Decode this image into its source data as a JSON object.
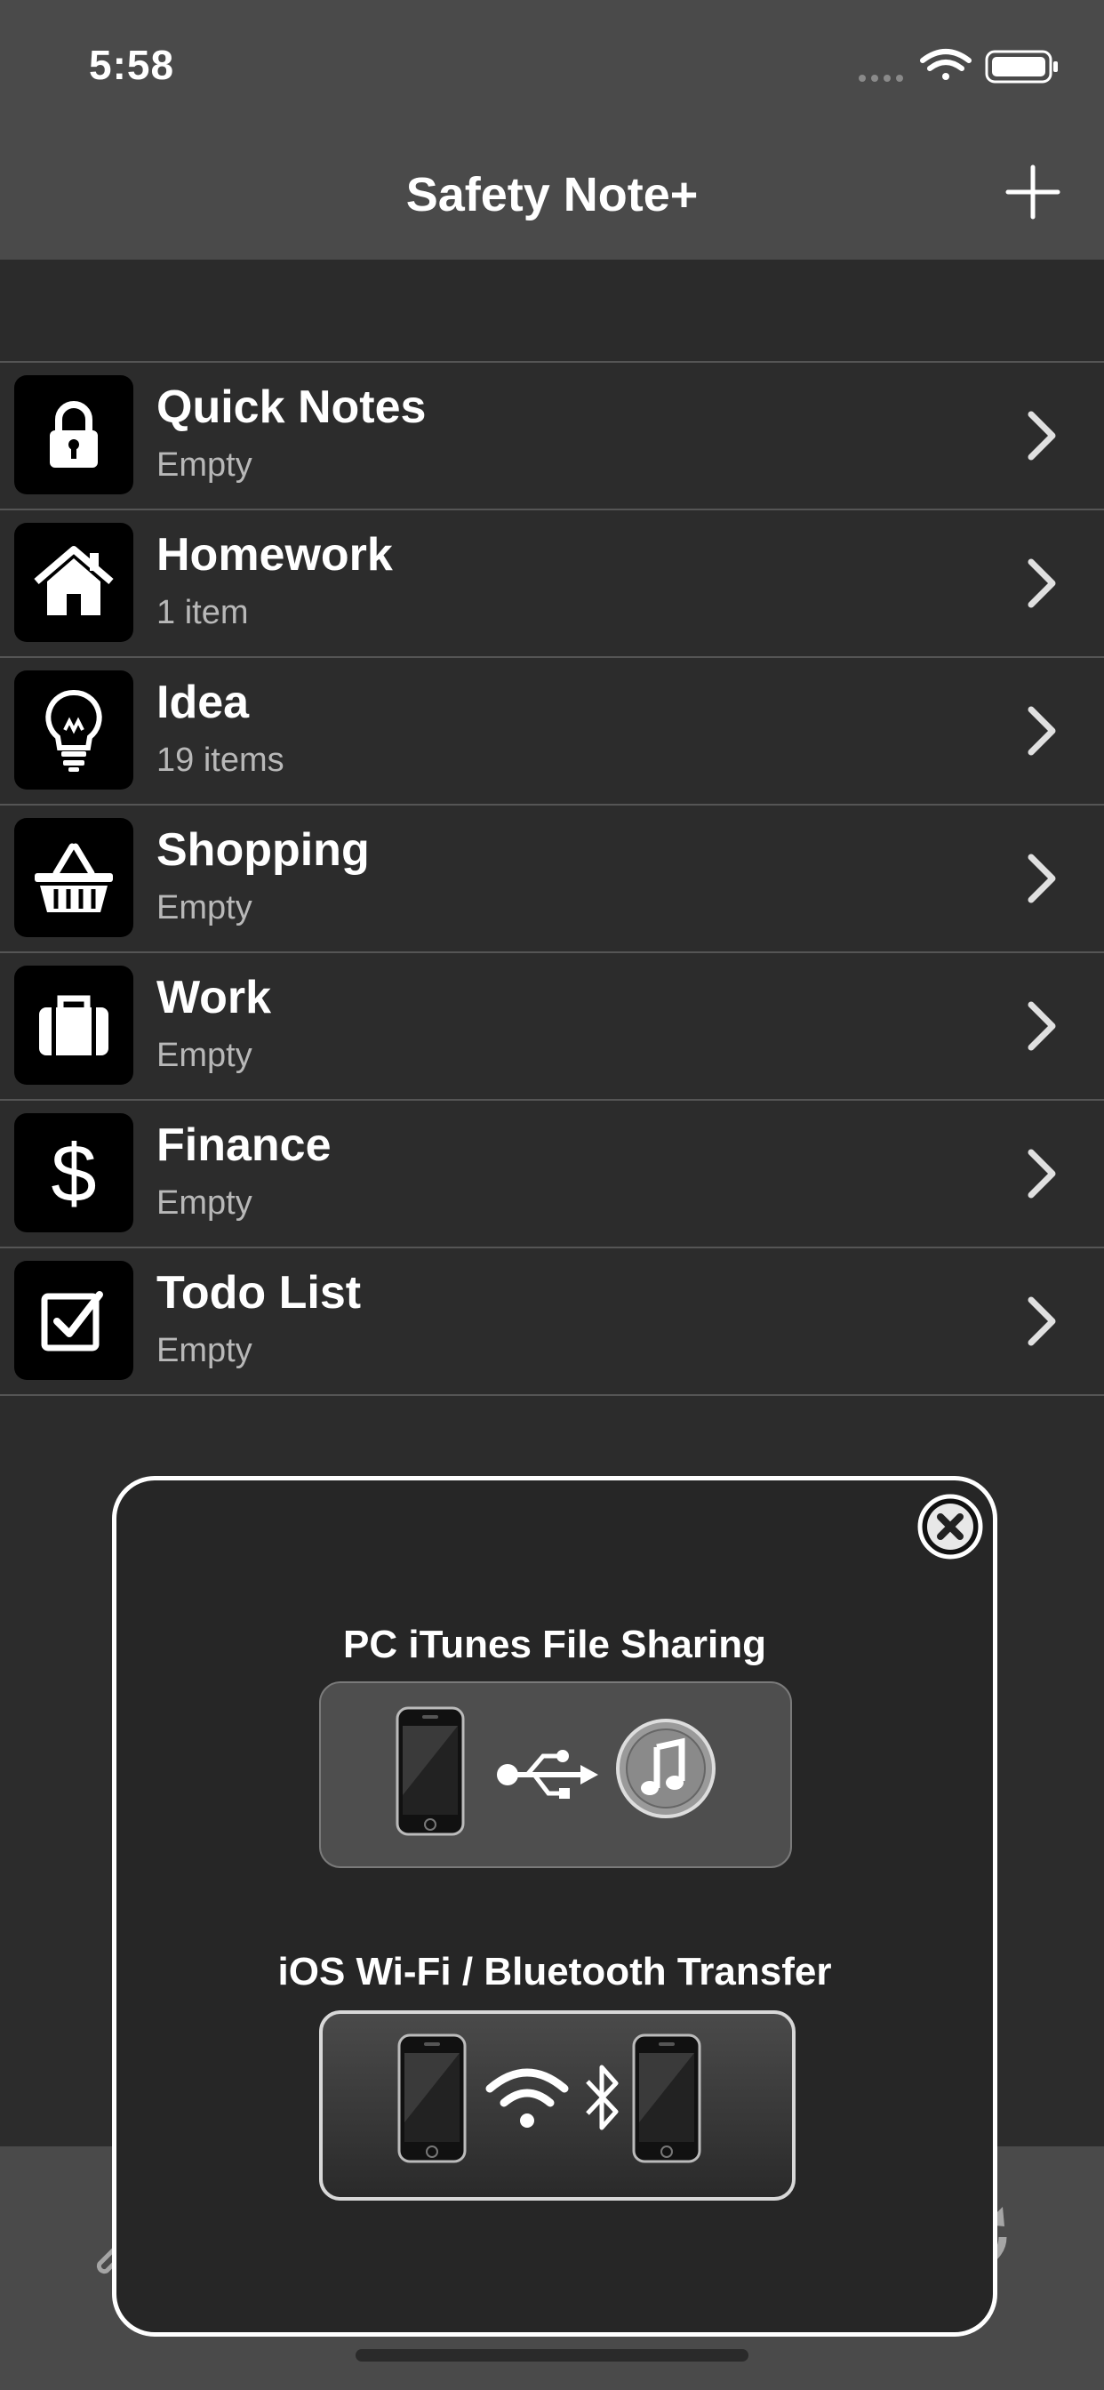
{
  "status": {
    "time": "5:58"
  },
  "nav": {
    "title": "Safety Note+"
  },
  "categories": [
    {
      "title": "Quick Notes",
      "subtitle": "Empty",
      "icon": "lock-icon"
    },
    {
      "title": "Homework",
      "subtitle": "1 item",
      "icon": "house-icon"
    },
    {
      "title": "Idea",
      "subtitle": "19 items",
      "icon": "lightbulb-icon"
    },
    {
      "title": "Shopping",
      "subtitle": "Empty",
      "icon": "basket-icon"
    },
    {
      "title": "Work",
      "subtitle": "Empty",
      "icon": "briefcase-icon"
    },
    {
      "title": "Finance",
      "subtitle": "Empty",
      "icon": "dollar-icon"
    },
    {
      "title": "Todo List",
      "subtitle": "Empty",
      "icon": "checkbox-icon"
    }
  ],
  "overlay": {
    "itunes_heading": "PC iTunes File Sharing",
    "wifi_heading": "iOS Wi-Fi / Bluetooth Transfer"
  },
  "tabbar": {
    "tabs": [
      "wrench-icon",
      "add-box-icon",
      "pencil-icon",
      "sync-icon"
    ]
  },
  "colors": {
    "bar": "#4a4a4a",
    "background": "#2c2c2c",
    "separator": "#555555",
    "subtitle": "#b8b8b8"
  }
}
